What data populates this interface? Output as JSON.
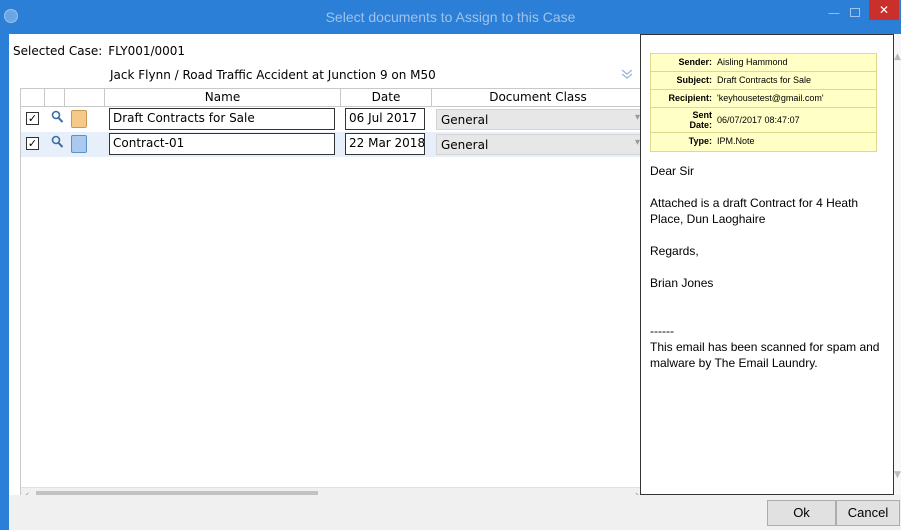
{
  "window": {
    "title": "Select documents to Assign to this Case",
    "minimize": "—",
    "close": "✕"
  },
  "case": {
    "label": "Selected Case:",
    "id": "FLY001/0001",
    "description": "Jack Flynn / Road Traffic Accident at Junction 9 on M50"
  },
  "grid": {
    "columns": [
      "Name",
      "Date",
      "Document Class"
    ],
    "rows": [
      {
        "checked": true,
        "checkmark": "✓",
        "icon": "email-icon",
        "name": "Draft Contracts for Sale",
        "date": "06 Jul 2017",
        "class": "General"
      },
      {
        "checked": true,
        "checkmark": "✓",
        "icon": "document-icon",
        "name": "Contract-01",
        "date": "22 Mar 2018",
        "class": "General"
      }
    ]
  },
  "preview": {
    "labels": {
      "sender": "Sender:",
      "subject": "Subject:",
      "recipient": "Recipient:",
      "sent_date": "Sent\nDate:",
      "type": "Type:"
    },
    "sender": "Aisling Hammond",
    "subject": "Draft Contracts for Sale",
    "recipient": "'keyhousetest@gmail.com'",
    "sent_date": "06/07/2017 08:47:07",
    "type": "IPM.Note",
    "body": [
      "Dear Sir",
      "Attached is a draft Contract for 4 Heath Place, Dun Laoghaire",
      "Regards,",
      "Brian Jones",
      "------\nThis email has been scanned for spam and malware by The Email Laundry."
    ]
  },
  "buttons": {
    "ok": "Ok",
    "cancel": "Cancel"
  },
  "colors": {
    "titlebar": "#2b7fd6",
    "close": "#c9302c",
    "meta_bg": "#ffffc6"
  }
}
